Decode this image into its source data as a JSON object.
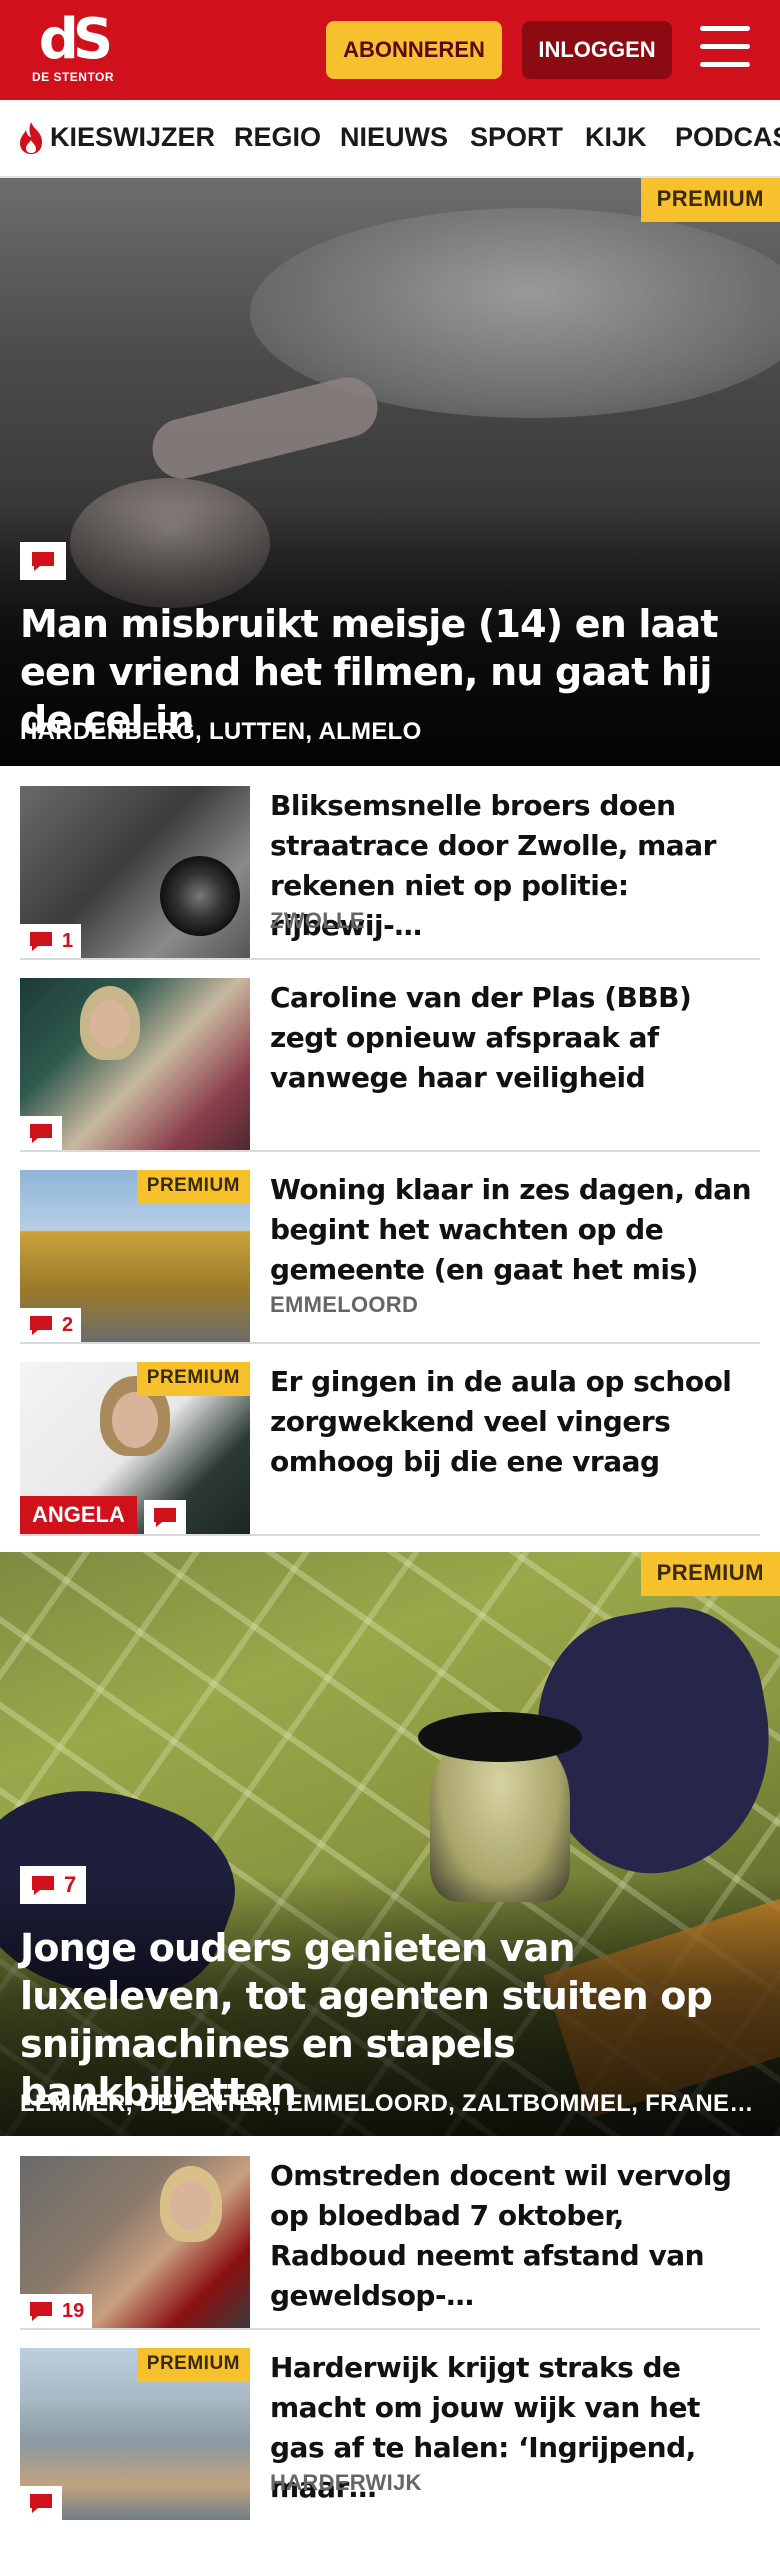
{
  "header": {
    "logo_mark": "dS",
    "logo_sub": "DE STENTOR",
    "subscribe_label": "ABONNEREN",
    "login_label": "INLOGGEN"
  },
  "nav": {
    "items": [
      "KIESWIJZER",
      "REGIO",
      "NIEUWS",
      "SPORT",
      "KIJK",
      "PODCAST"
    ]
  },
  "hero1": {
    "premium": "PREMIUM",
    "title": "Man misbruikt meisje (14) en laat een vriend het filmen, nu gaat hij de cel in",
    "location": "HARDENBERG, LUTTEN, ALMELO"
  },
  "articles1": [
    {
      "title": "Bliksemsnelle broers doen straatrace door Zwolle, maar rekenen niet op politie: rijbewij-…",
      "location": "ZWOLLE",
      "comments": "1"
    },
    {
      "title": "Caroline van der Plas (BBB) zegt opnieuw afspraak af vanwege haar veiligheid",
      "location": "",
      "comments": ""
    },
    {
      "premium": "PREMIUM",
      "title": "Woning klaar in zes dagen, dan begint het wachten op de gemeente (en gaat het mis)",
      "location": "EMMELOORD",
      "comments": "2"
    },
    {
      "premium": "PREMIUM",
      "label": "ANGELA",
      "title": "Er gingen in de aula op school zorgwekkend veel vingers omhoog bij die ene vraag",
      "location": "",
      "comments": ""
    }
  ],
  "hero2": {
    "premium": "PREMIUM",
    "comments": "7",
    "title": "Jonge ouders genieten van luxeleven, tot agenten stuiten op snijmachines en stapels bankbiljetten",
    "location": "LEMMER, DEVENTER, EMMELOORD, ZALTBOMMEL, FRANEK…"
  },
  "articles2": [
    {
      "title": "Omstreden docent wil vervolg op bloedbad 7 oktober, Radboud neemt afstand van geweldsop-…",
      "location": "",
      "comments": "19"
    },
    {
      "premium": "PREMIUM",
      "title": "Harderwijk krijgt straks de macht om jouw wijk van het gas af te halen: ‘Ingrijpend, maar…",
      "location": "HARDERWIJK",
      "comments": ""
    }
  ],
  "colors": {
    "brand_red": "#d0101b",
    "premium_yellow": "#f7c12d",
    "login_dark_red": "#8c0a12"
  },
  "icons": {
    "comment": "comment-bubble-icon",
    "flame": "flame-icon",
    "menu": "hamburger-menu-icon"
  }
}
